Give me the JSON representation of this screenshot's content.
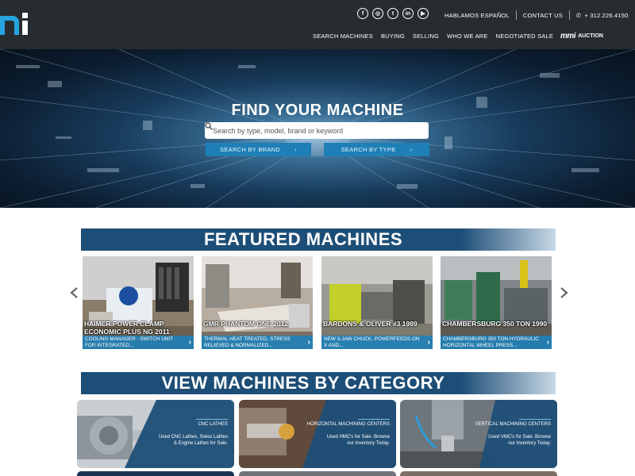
{
  "header": {
    "social": [
      "facebook-icon",
      "instagram-icon",
      "twitter-icon",
      "linkedin-icon",
      "youtube-icon"
    ],
    "hablamos": "HABLAMOS ESPAÑOL",
    "contact": "CONTACT US",
    "phone": "+ 312.226.4150",
    "nav": [
      "SEARCH MACHINES",
      "BUYING",
      "SELLING",
      "WHO WE ARE",
      "NEGOTIATED SALE"
    ],
    "auction_logo": "mmi",
    "auction": "AUCTION"
  },
  "hero": {
    "title": "FIND YOUR MACHINE",
    "search_placeholder": "Search by type, model, brand or keyword",
    "brand_button": "SEARCH BY BRAND",
    "type_button": "SEARCH BY TYPE"
  },
  "featured": {
    "title": "FEATURED MACHINES",
    "cards": [
      {
        "name": "HAIMER POWER CLAMP ECONOMIC PLUS NG 2011",
        "desc": "COOLING MANAGER - SWITCH UNIT FOR INTEGRATED..."
      },
      {
        "name": "GMR PHANTOM ONE 2012",
        "desc": "THERMAL HEAT TREATED, STRESS RELIEVED & NORMALIZED..."
      },
      {
        "name": "BARDONS & OLIVER #3 1989",
        "desc": "NEW 3-JAW CHUCK, POWERFEEDS ON X AND..."
      },
      {
        "name": "CHAMBERSBURG 350 TON 1990",
        "desc": "CHAMBERSBURG 350 TON HYDRAULIC HORIZONTAL WHEEL PRESS..."
      }
    ]
  },
  "categories": {
    "title": "VIEW MACHINES BY CATEGORY",
    "items": [
      {
        "title": "CNC LATHES",
        "desc": "Used CNC Lathes, Swiss Lathes & Engine Lathes for Sale."
      },
      {
        "title": "HORIZONTAL MACHINING CENTERS",
        "desc": "Used HMC's for Sale. Browse our Inventory Today."
      },
      {
        "title": "VERTICAL MACHINING CENTERS",
        "desc": "Used VMC's for Sale. Browse our Inventory Today."
      }
    ]
  },
  "colors": {
    "header_bg": "#272c31",
    "accent": "#1f80b8",
    "band": "#1d4e77"
  }
}
